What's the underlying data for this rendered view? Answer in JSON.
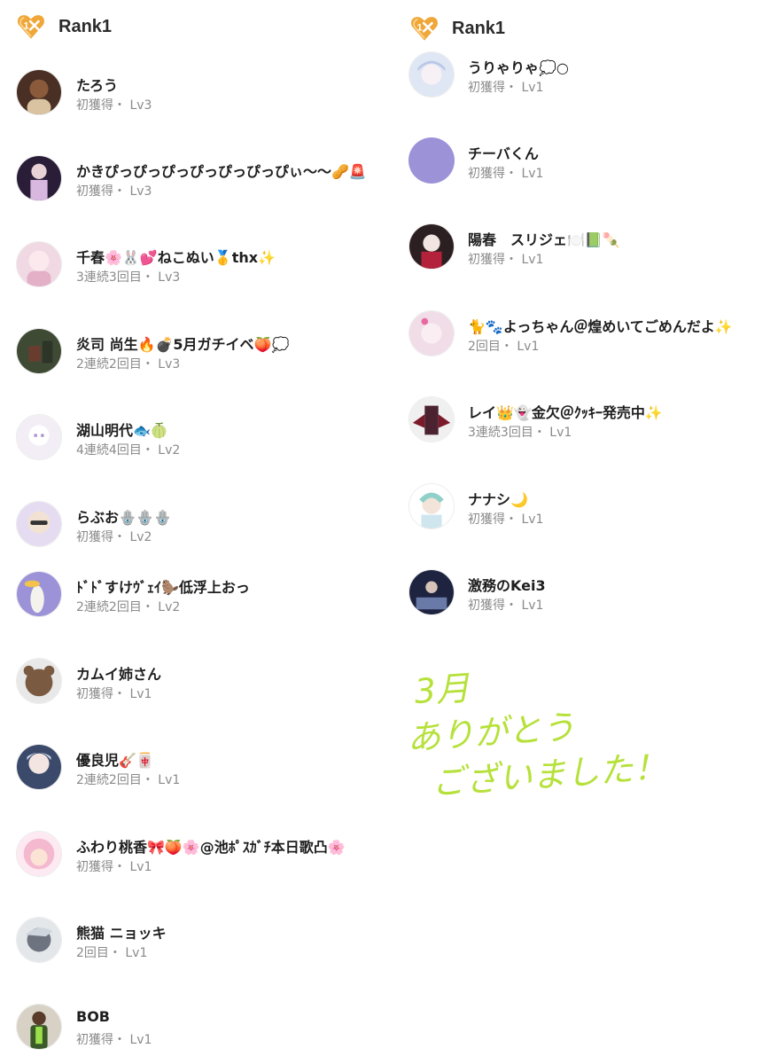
{
  "left": {
    "header": {
      "title": "Rank1",
      "icon": "rank1-badge-icon"
    },
    "rows": [
      {
        "name": "たろう",
        "meta": "初獲得・ Lv3",
        "avatar": "#4a2f24"
      },
      {
        "name": "かきぴっぴっぴっぴっぴっぴっぴぃ〜〜🥜🚨",
        "meta": "初獲得・ Lv3",
        "avatar": "#2a1d38"
      },
      {
        "name": "千春🌸🐰💕ねこぬい🥇thx✨",
        "meta": "3連続3回目・ Lv3",
        "avatar": "#f1d9e3"
      },
      {
        "name": "炎司 尚生🔥💣5月ガチイベ🍑💭",
        "meta": "2連続2回目・ Lv3",
        "avatar": "#3f4a35"
      },
      {
        "name": "湖山明代🐟🍈",
        "meta": "4連続4回目・ Lv2",
        "avatar": "#f3eef6"
      },
      {
        "name": "らぶお🪬🪬🪬",
        "meta": "初獲得・ Lv2",
        "avatar": "#e5dcf2"
      },
      {
        "name": "ﾄﾞﾄﾞすけｳﾞｪｲ🦫低浮上おっ",
        "meta": "2連続2回目・ Lv2",
        "avatar": "#9c92d8"
      },
      {
        "name": "カムイ姉さん",
        "meta": "初獲得・ Lv1",
        "avatar": "#7a5a40"
      },
      {
        "name": "優良児🎸🀄",
        "meta": "2連続2回目・ Lv1",
        "avatar": "#3b4a6b"
      },
      {
        "name": "ふわり桃香🎀🍑🌸@池ﾎﾟｽｶﾞﾁ本日歌凸🌸",
        "meta": "初獲得・ Lv1",
        "avatar": "#f4b8cf"
      },
      {
        "name": "熊猫 ニョッキ",
        "meta": "2回目・ Lv1",
        "avatar": "#6d7480"
      },
      {
        "name": "BOB",
        "meta": "初獲得・ Lv1",
        "avatar": "#3a5a2a"
      }
    ]
  },
  "right": {
    "header": {
      "title": "Rank1",
      "icon": "rank1-badge-icon"
    },
    "rows": [
      {
        "name": "うりゃりゃ💭○",
        "meta": "初獲得・ Lv1",
        "avatar": "#dfe6f4"
      },
      {
        "name": "チーバくん",
        "meta": "初獲得・ Lv1",
        "avatar": "#9c92d8"
      },
      {
        "name": "陽春　スリジェ🍽️📗🍡",
        "meta": "初獲得・ Lv1",
        "avatar": "#2c1f22"
      },
      {
        "name": "🐈🐾よっちゃん＠煌めいてごめんだよ✨",
        "meta": "2回目・ Lv1",
        "avatar": "#f1dde8"
      },
      {
        "name": "レイ👑👻金欠＠ｸｯｷｰ発売中✨",
        "meta": "3連続3回目・ Lv1",
        "avatar": "#4a2230"
      },
      {
        "name": "ナナシ🌙",
        "meta": "初獲得・ Lv1",
        "avatar": "#cfe6ef"
      },
      {
        "name": "激務のKei3",
        "meta": "初獲得・ Lv1",
        "avatar": "#1e2440"
      }
    ]
  },
  "handwritten_message": [
    "3月",
    "ありがとう",
    "ございました！"
  ],
  "colors": {
    "badge": "#f0a73a",
    "handwriting": "#b6e13a",
    "meta": "#8a8a8a"
  }
}
